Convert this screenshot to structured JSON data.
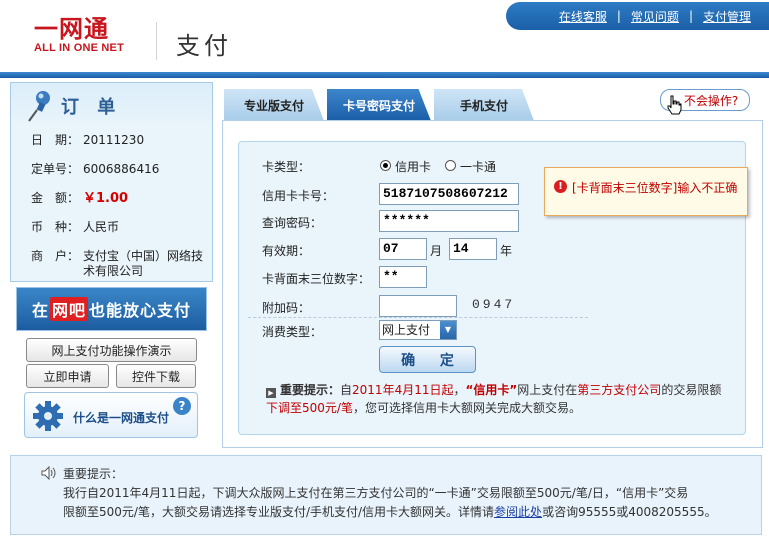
{
  "header": {
    "logo_cn": "一网通",
    "logo_en": "ALL IN ONE NET",
    "page_title": "支付",
    "nav": [
      "在线客服",
      "常见问题",
      "支付管理"
    ],
    "nav_sep": "|"
  },
  "order": {
    "title": "订 单",
    "rows": [
      {
        "label": "日　期：",
        "value": "20111230"
      },
      {
        "label": "定单号：",
        "value": "6006886416"
      },
      {
        "label": "金　额：",
        "value": "￥1.00"
      },
      {
        "label": "币　种：",
        "value": "人民币"
      },
      {
        "label": "商　户：",
        "value": "支付宝（中国）网络技术有限公司"
      }
    ]
  },
  "promo": {
    "prefix": "在",
    "highlight": "网吧",
    "suffix": "也能放心支付"
  },
  "side_buttons": {
    "demo": "网上支付功能操作演示",
    "apply": "立即申请",
    "download": "控件下载",
    "whatis": "什么是一网通支付",
    "whatis_q": "?"
  },
  "tabs": [
    {
      "label": "专业版支付",
      "active": false
    },
    {
      "label": "卡号密码支付",
      "active": true
    },
    {
      "label": "手机支付",
      "active": false
    }
  ],
  "help_button": "不会操作?",
  "form": {
    "card_type_label": "卡类型：",
    "card_type_options": [
      "信用卡",
      "一卡通"
    ],
    "card_type_selected": "信用卡",
    "card_no_label": "信用卡卡号：",
    "card_no_value": "5187107508607212",
    "query_pwd_label": "查询密码：",
    "query_pwd_value": "******",
    "expiry_label": "有效期：",
    "expiry_month": "07",
    "month_unit": "月",
    "expiry_year": "14",
    "year_unit": "年",
    "cvv_label": "卡背面末三位数字：",
    "cvv_value": "**",
    "extra_code_label": "附加码：",
    "extra_code_value": "",
    "captcha": "0947",
    "consume_type_label": "消费类型：",
    "consume_type_value": "网上支付",
    "confirm_button": "确 定"
  },
  "error": {
    "message": "[卡背面末三位数字]输入不正确"
  },
  "form_notice": {
    "lead": "重要提示：",
    "p1": "自",
    "date": "2011年4月11日起",
    "p2": "，",
    "credit": "“信用卡”",
    "p3": "网上支付在",
    "third": "第三方支付公司",
    "p4": "的交易限额",
    "lower": "下调至500元/笔",
    "p5": "，您可选择信用卡大额网关完成大额交易。"
  },
  "bottom_notice": {
    "title": "重要提示：",
    "line1": "我行自2011年4月11日起，下调大众版网上支付在第三方支付公司的“一卡通”交易限额至500元/笔/日，“信用卡”交易",
    "line2_pre": "限额至500元/笔，大额交易请选择专业版支付/手机支付/信用卡大额网关。详情请",
    "link": "参阅此处",
    "line2_post": "或咨询95555或4008205555。"
  },
  "colors": {
    "brand_red": "#c8161e",
    "brand_blue": "#1b5ea8",
    "error_red": "#c00000"
  }
}
